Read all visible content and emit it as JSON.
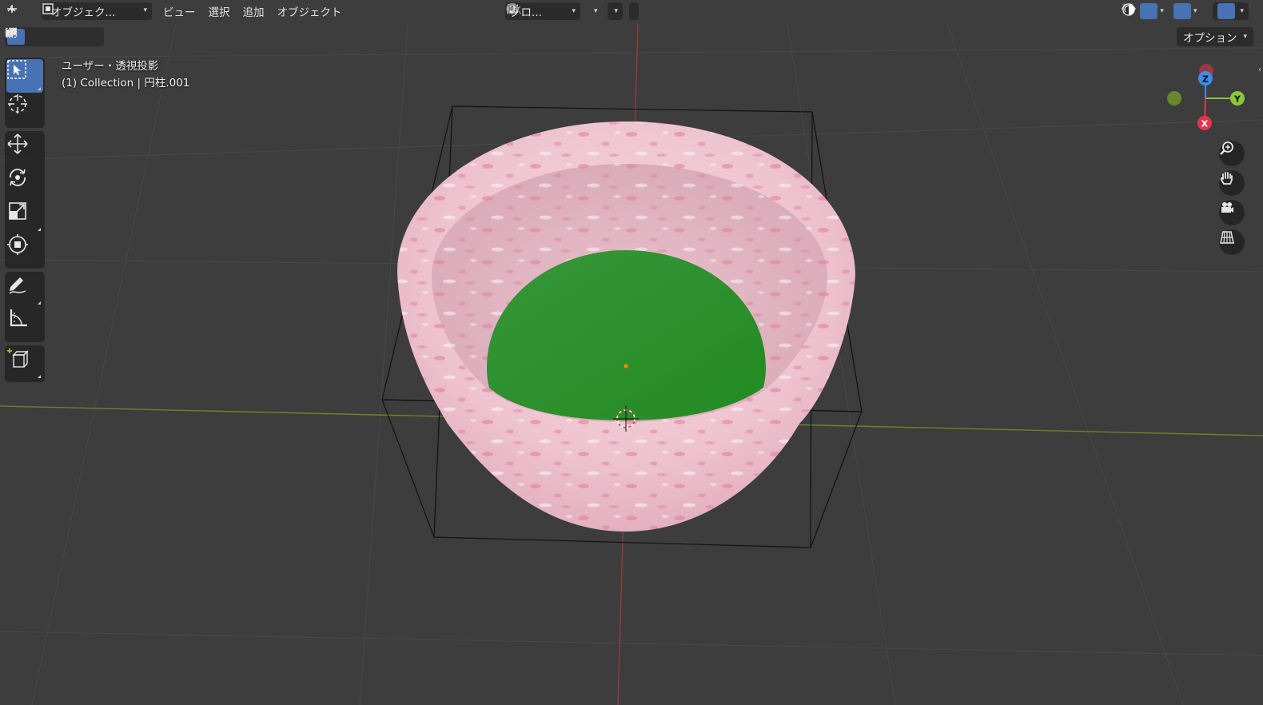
{
  "header": {
    "mode_label": "オブジェク...",
    "menus": [
      "ビュー",
      "選択",
      "追加",
      "オブジェクト"
    ],
    "transform_orientation": "グロ...",
    "options_label": "オプション"
  },
  "overlay": {
    "view_name": "ユーザー・透視投影",
    "object_info": "(1) Collection | 円柱.001"
  },
  "gizmo": {
    "z_label": "Z",
    "y_label": "Y",
    "x_label": "X",
    "colors": {
      "x": "#e6344f",
      "y": "#8cc63f",
      "z": "#3c8ded"
    }
  },
  "toolbar": {
    "tools": [
      "select-box-tool",
      "cursor-tool",
      "move-tool",
      "rotate-tool",
      "scale-tool",
      "transform-tool",
      "annotate-tool",
      "measure-tool",
      "add-cube-tool"
    ],
    "active_tool": "select-box-tool"
  },
  "scene": {
    "object_colors": {
      "rim": "#f2c8d4",
      "interior": "#2a8f2a",
      "bbox": "#111111"
    }
  }
}
